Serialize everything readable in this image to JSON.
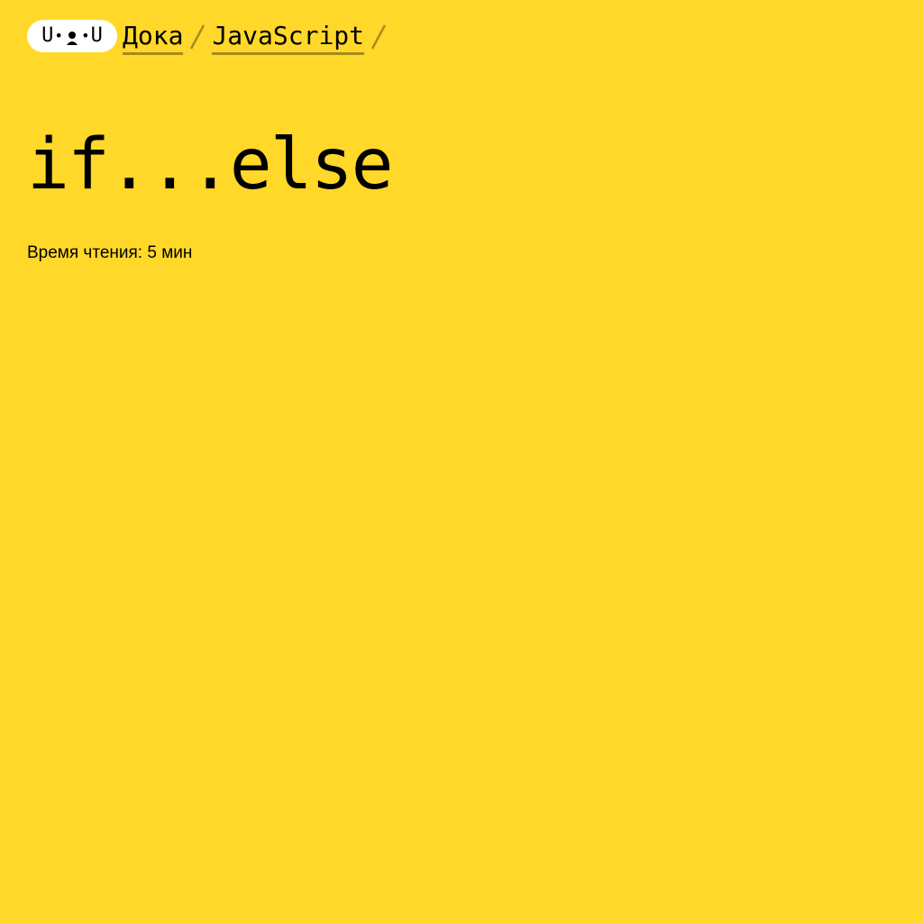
{
  "header": {
    "logo": {
      "left_glyph": "U",
      "right_glyph": "U",
      "icon": "doka-logo-face-icon"
    },
    "breadcrumbs": [
      {
        "label": "Дока"
      },
      {
        "label": "JavaScript"
      }
    ],
    "separator_icon": "slash-separator-icon"
  },
  "main": {
    "title": "if...else",
    "reading_time": "Время чтения: 5 мин"
  },
  "colors": {
    "background": "#ffd829",
    "logo_background": "#ffffff",
    "text": "#000000"
  }
}
